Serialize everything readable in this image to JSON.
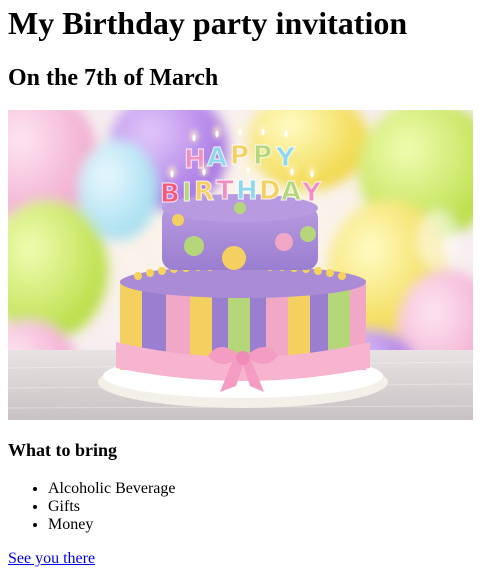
{
  "page": {
    "title": "My Birthday party invitation",
    "subtitle": "On the 7th of March"
  },
  "image": {
    "candle_letters": [
      "H",
      "A",
      "P",
      "P",
      "Y",
      "B",
      "I",
      "R",
      "T",
      "H",
      "D",
      "A",
      "Y"
    ],
    "colors": {
      "cake_top": "#a98bd6",
      "cake_bottom": "#9a7ed0",
      "stripe_yellow": "#f4d060",
      "stripe_green": "#b6d67a",
      "stripe_pink": "#f1a7c6",
      "ribbon": "#f7b4cf"
    }
  },
  "bring": {
    "heading": "What to bring",
    "items": [
      {
        "label": "Alcoholic Beverage"
      },
      {
        "label": "Gifts"
      },
      {
        "label": "Money"
      }
    ]
  },
  "footer": {
    "link_label": "See you there"
  },
  "colors": {
    "link": "#0000ee",
    "text": "#000000",
    "background": "#ffffff"
  }
}
